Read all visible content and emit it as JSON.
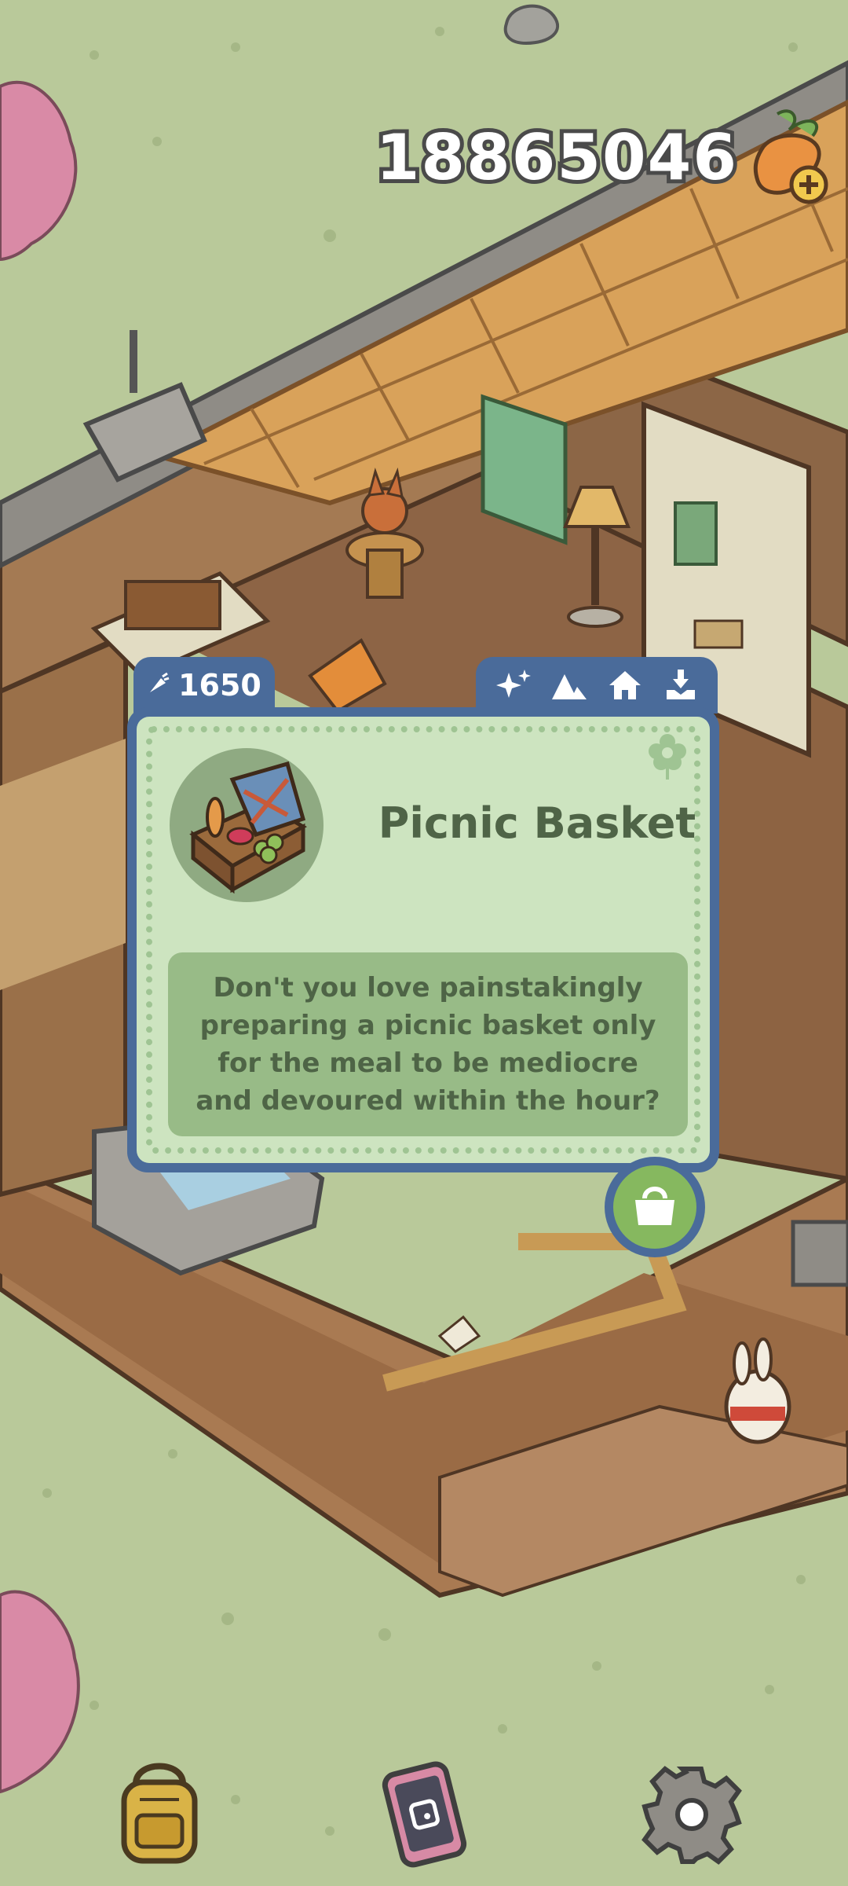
{
  "hud": {
    "currency_amount": "18865046",
    "currency_icon": "carrot-add-icon"
  },
  "item_card": {
    "price": "1650",
    "price_icon": "carrot-icon",
    "name": "Picnic Basket",
    "description": "Don't you love painstakingly preparing a picnic basket only for the meal to be mediocre and devoured within the hour?",
    "tag_icons": [
      "sparkle-icon",
      "mountain-icon",
      "house-icon",
      "place-icon"
    ],
    "action_icon": "bag-icon"
  },
  "bottom_bar": {
    "items": [
      {
        "icon": "backpack-icon"
      },
      {
        "icon": "phone-icon"
      },
      {
        "icon": "gear-icon"
      }
    ]
  },
  "colors": {
    "grass": "#b9c99a",
    "card_border": "#4a6b9a",
    "card_bg": "#cde4c0",
    "text_green": "#4f6447"
  }
}
